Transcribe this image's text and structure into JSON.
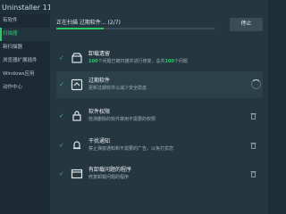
{
  "app": {
    "title": "Uninstaller 11"
  },
  "sidebar": {
    "items": [
      {
        "label": "有软件"
      },
      {
        "label": "扫描器"
      },
      {
        "label": "新扫描器"
      },
      {
        "label": "浏览器扩展插件"
      },
      {
        "label": "Windows应用"
      },
      {
        "label": "动作中心"
      }
    ]
  },
  "scan": {
    "status": "正在扫描 过期软件... (2/7)",
    "progress_fraction": 0.3,
    "stop_label": "停止"
  },
  "rows": [
    {
      "title": "卸载遗留",
      "desc_count": "100",
      "desc_mid": "个问题已被扫描并进行修复，总共",
      "desc_total": "100",
      "desc_tail": "个问题"
    },
    {
      "title": "过期软件",
      "desc": "更新过期软件以减少安全隐患"
    },
    {
      "title": "软件权限",
      "desc": "检测删除的软件禁用不需要的权限"
    },
    {
      "title": "干扰通知",
      "desc": "禁止弹窗通知和不需要的广告，以免打扰您"
    },
    {
      "title": "有卸载问题的程序",
      "desc": "修复卸载问题的程序"
    }
  ],
  "colors": {
    "accent": "#2fc66a",
    "background": "#243640",
    "sidebar": "#1b2a33"
  }
}
